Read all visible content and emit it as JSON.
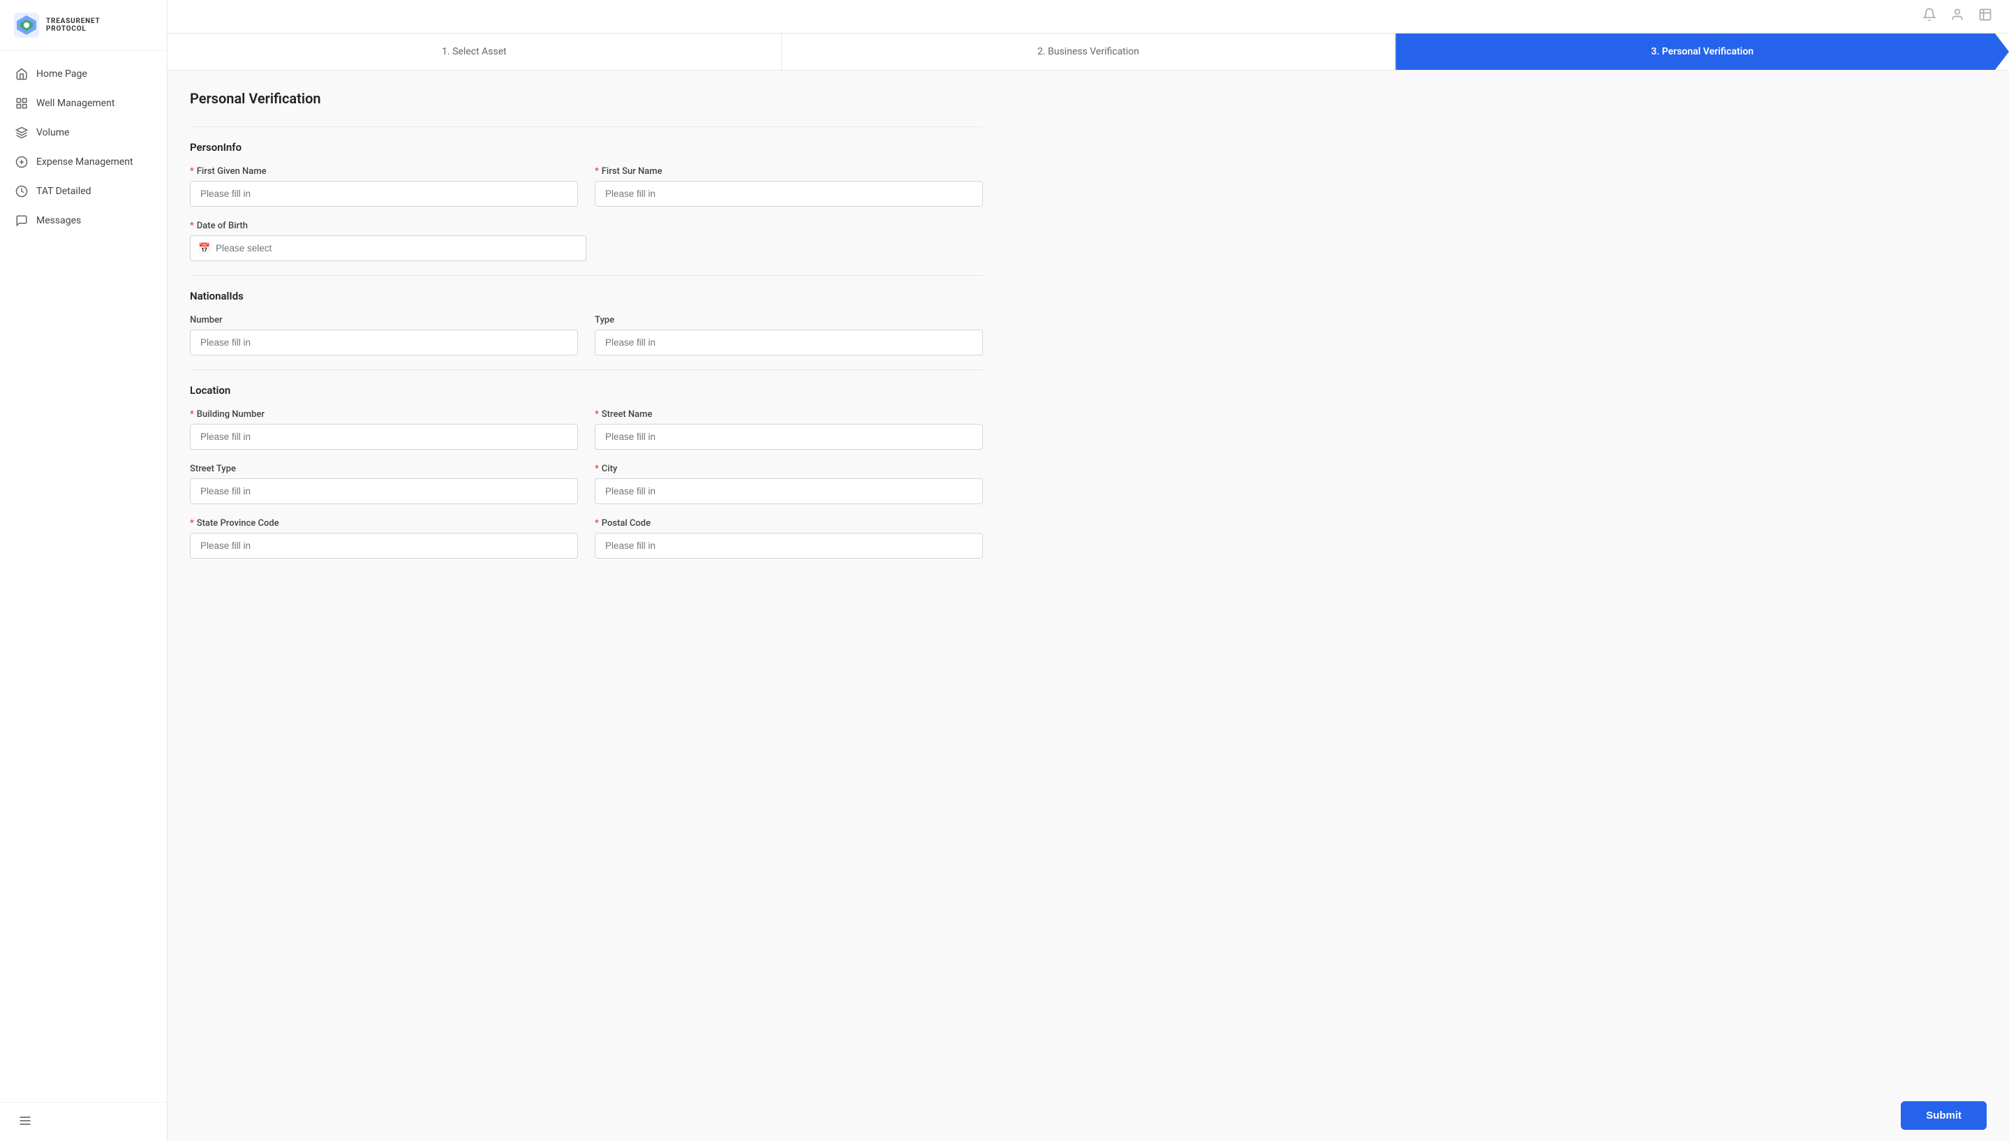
{
  "app": {
    "logo_line1": "TREASURENET",
    "logo_line2": "PROTOCOL"
  },
  "sidebar": {
    "items": [
      {
        "id": "home",
        "label": "Home Page",
        "icon": "home"
      },
      {
        "id": "well",
        "label": "Well Management",
        "icon": "grid"
      },
      {
        "id": "volume",
        "label": "Volume",
        "icon": "volume"
      },
      {
        "id": "expense",
        "label": "Expense Management",
        "icon": "expense"
      },
      {
        "id": "tat",
        "label": "TAT Detailed",
        "icon": "clock"
      },
      {
        "id": "messages",
        "label": "Messages",
        "icon": "messages"
      }
    ]
  },
  "stepper": {
    "steps": [
      {
        "id": "select-asset",
        "label": "1. Select Asset",
        "active": false
      },
      {
        "id": "business-verification",
        "label": "2. Business Verification",
        "active": false
      },
      {
        "id": "personal-verification",
        "label": "3. Personal Verification",
        "active": true
      }
    ]
  },
  "page": {
    "title": "Personal Verification",
    "sections": {
      "person_info": {
        "title": "PersonInfo",
        "fields": {
          "first_given_name": {
            "label": "First Given Name",
            "required": true,
            "placeholder": "Please fill in"
          },
          "first_sur_name": {
            "label": "First Sur Name",
            "required": true,
            "placeholder": "Please fill in"
          },
          "date_of_birth": {
            "label": "Date of Birth",
            "required": true,
            "placeholder": "Please select"
          }
        }
      },
      "national_ids": {
        "title": "NationalIds",
        "fields": {
          "number": {
            "label": "Number",
            "required": false,
            "placeholder": "Please fill in"
          },
          "type": {
            "label": "Type",
            "required": false,
            "placeholder": "Please fill in"
          }
        }
      },
      "location": {
        "title": "Location",
        "fields": {
          "building_number": {
            "label": "Building Number",
            "required": true,
            "placeholder": "Please fill in"
          },
          "street_name": {
            "label": "Street Name",
            "required": true,
            "placeholder": "Please fill in"
          },
          "street_type": {
            "label": "Street Type",
            "required": false,
            "placeholder": "Please fill in"
          },
          "city": {
            "label": "City",
            "required": true,
            "placeholder": "Please fill in"
          },
          "state_province_code": {
            "label": "State Province Code",
            "required": true,
            "placeholder": "Please fill in"
          },
          "postal_code": {
            "label": "Postal Code",
            "required": true,
            "placeholder": "Please fill in"
          }
        }
      }
    }
  },
  "buttons": {
    "submit": "Submit"
  }
}
